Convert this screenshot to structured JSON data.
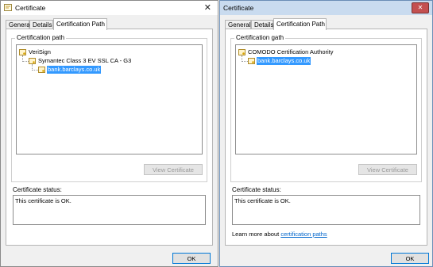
{
  "left": {
    "title": "Certificate",
    "tabs": [
      "General",
      "Details",
      "Certification Path"
    ],
    "group_label": "Certification path",
    "tree": [
      "VeriSign",
      "Symantec Class 3 EV SSL CA - G3",
      "bank.barclays.co.uk"
    ],
    "view_button": "View Certificate",
    "status_label": "Certificate status:",
    "status_text": "This certificate is OK.",
    "ok": "OK",
    "close": "✕"
  },
  "right": {
    "title": "Certificate",
    "tabs": [
      "General",
      "Details",
      "Certification Path"
    ],
    "group_label": "Certification gath",
    "tree": [
      "COMODO Certification Authority",
      "bank.barclays.co.uk"
    ],
    "view_button": "View Certificate",
    "status_label": "Certificate status:",
    "status_text": "This certificate is OK.",
    "learn_prefix": "Learn more about",
    "learn_link": "certification paths",
    "ok": "OK",
    "close": "✕"
  },
  "icons": {
    "certificate": "certificate-icon",
    "close": "close-icon"
  },
  "colors": {
    "selection": "#3399ff",
    "link": "#0066cc",
    "close_button": "#c45050"
  }
}
